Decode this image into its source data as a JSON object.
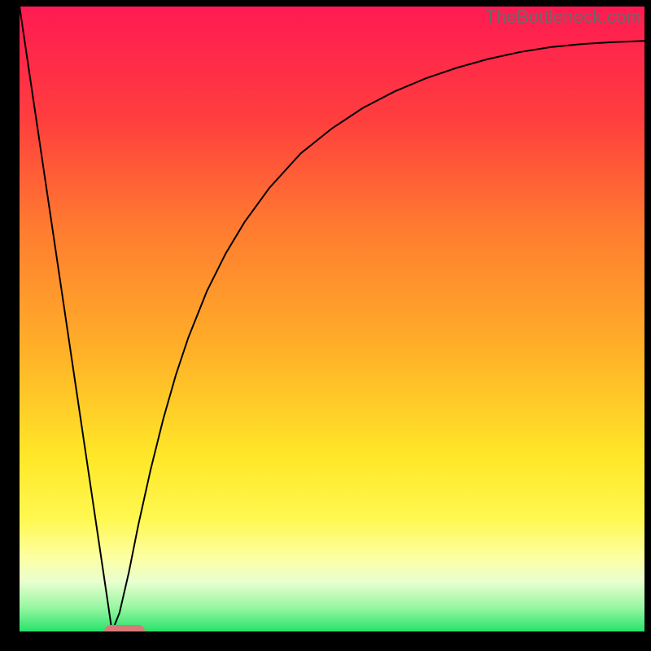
{
  "watermark": {
    "text": "TheBottleneck.com"
  },
  "chart_data": {
    "type": "line",
    "title": "",
    "xlabel": "",
    "ylabel": "",
    "xlim": [
      0,
      100
    ],
    "ylim": [
      0,
      100
    ],
    "grid": false,
    "background_gradient": {
      "stops": [
        {
          "pos": 0.0,
          "color": "#ff1a52"
        },
        {
          "pos": 0.18,
          "color": "#ff3e3e"
        },
        {
          "pos": 0.35,
          "color": "#ff7a30"
        },
        {
          "pos": 0.55,
          "color": "#ffb028"
        },
        {
          "pos": 0.72,
          "color": "#ffe728"
        },
        {
          "pos": 0.82,
          "color": "#fff850"
        },
        {
          "pos": 0.88,
          "color": "#fdffa0"
        },
        {
          "pos": 0.92,
          "color": "#e9ffcf"
        },
        {
          "pos": 0.96,
          "color": "#9cf7a4"
        },
        {
          "pos": 1.0,
          "color": "#27e36b"
        }
      ]
    },
    "series": [
      {
        "name": "bottleneck-curve",
        "stroke": "#000000",
        "stroke_width": 2,
        "x": [
          0.0,
          2.0,
          4.0,
          6.0,
          8.0,
          10.0,
          12.0,
          14.0,
          14.8,
          16.0,
          17.5,
          19.0,
          21.0,
          23.0,
          25.0,
          27.0,
          30.0,
          33.0,
          36.0,
          40.0,
          45.0,
          50.0,
          55.0,
          60.0,
          65.0,
          70.0,
          75.0,
          80.0,
          85.0,
          90.0,
          95.0,
          100.0
        ],
        "y": [
          100.0,
          86.5,
          73.0,
          59.5,
          46.0,
          32.5,
          19.0,
          5.5,
          0.0,
          3.0,
          9.5,
          17.0,
          26.0,
          34.0,
          41.0,
          47.0,
          54.5,
          60.5,
          65.5,
          71.0,
          76.5,
          80.5,
          83.8,
          86.4,
          88.5,
          90.2,
          91.6,
          92.7,
          93.5,
          94.0,
          94.3,
          94.5
        ]
      }
    ],
    "marker": {
      "name": "optimal-range",
      "shape": "pill",
      "x_center": 16.8,
      "y": 0.0,
      "width_x_units": 6.4,
      "height_y_units": 2.0,
      "color": "#d97a7a"
    }
  }
}
